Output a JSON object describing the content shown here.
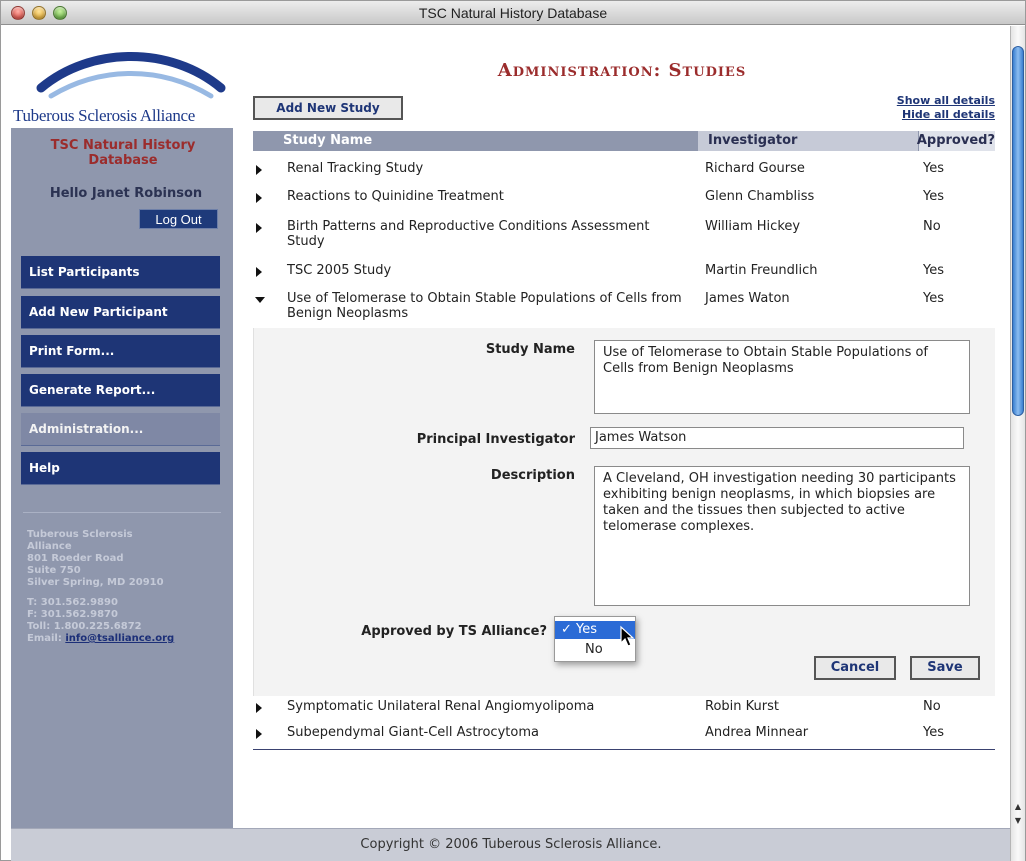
{
  "window": {
    "title": "TSC Natural History Database"
  },
  "sidebar": {
    "logo_text": "Tuberous Sclerosis Alliance",
    "db_title": "TSC Natural History Database",
    "greeting": "Hello Janet Robinson",
    "logout_label": "Log Out",
    "nav": [
      {
        "label": "List Participants"
      },
      {
        "label": "Add New Participant"
      },
      {
        "label": "Print Form..."
      },
      {
        "label": "Generate Report..."
      },
      {
        "label": "Administration..."
      },
      {
        "label": "Help"
      }
    ],
    "address": {
      "line1": "Tuberous Sclerosis",
      "line2": "Alliance",
      "line3": "801 Roeder Road",
      "line4": "Suite 750",
      "line5": "Silver Spring, MD 20910",
      "phone": "T: 301.562.9890",
      "fax": "F: 301.562.9870",
      "toll": "Toll: 1.800.225.6872",
      "email_label": "Email:",
      "email": "info@tsalliance.org"
    }
  },
  "main": {
    "heading": "Administration: Studies",
    "add_button": "Add New Study",
    "show_all": "Show all details",
    "hide_all": "Hide all details",
    "columns": {
      "name": "Study Name",
      "investigator": "Investigator",
      "approved": "Approved?"
    },
    "rows": [
      {
        "name": "Renal Tracking Study",
        "investigator": "Richard Gourse",
        "approved": "Yes"
      },
      {
        "name": "Reactions to Quinidine Treatment",
        "investigator": "Glenn Chambliss",
        "approved": "Yes"
      },
      {
        "name": "Birth Patterns and Reproductive Conditions Assessment Study",
        "investigator": "William Hickey",
        "approved": "No"
      },
      {
        "name": "TSC 2005 Study",
        "investigator": "Martin Freundlich",
        "approved": "Yes"
      },
      {
        "name": "Use of Telomerase to Obtain Stable Populations of Cells from Benign Neoplasms",
        "investigator": "James Waton",
        "approved": "Yes"
      },
      {
        "name": "Symptomatic Unilateral Renal Angiomyolipoma",
        "investigator": "Robin Kurst",
        "approved": "No"
      },
      {
        "name": "Subependymal Giant-Cell Astrocytoma",
        "investigator": "Andrea Minnear",
        "approved": "Yes"
      }
    ],
    "detail": {
      "study_name_label": "Study Name",
      "study_name_value": "Use of Telomerase to Obtain Stable Populations of Cells from Benign Neoplasms",
      "pi_label": "Principal Investigator",
      "pi_value": "James Watson",
      "description_label": "Description",
      "description_value": "A Cleveland, OH investigation needing 30 participants exhibiting benign neoplasms, in which biopsies are taken and the tissues then subjected to active telomerase complexes.",
      "approved_label": "Approved by TS Alliance?",
      "approved_options": [
        "Yes",
        "No"
      ],
      "approved_selected": "Yes",
      "checkmark": "✓",
      "cancel_label": "Cancel",
      "save_label": "Save"
    }
  },
  "footer": {
    "copyright": "Copyright © 2006 Tuberous Sclerosis Alliance."
  },
  "colors": {
    "nav": "#1e3576",
    "sidebar": "#8f97ad",
    "heading": "#9b2c2c",
    "selection": "#2b6bd6"
  }
}
